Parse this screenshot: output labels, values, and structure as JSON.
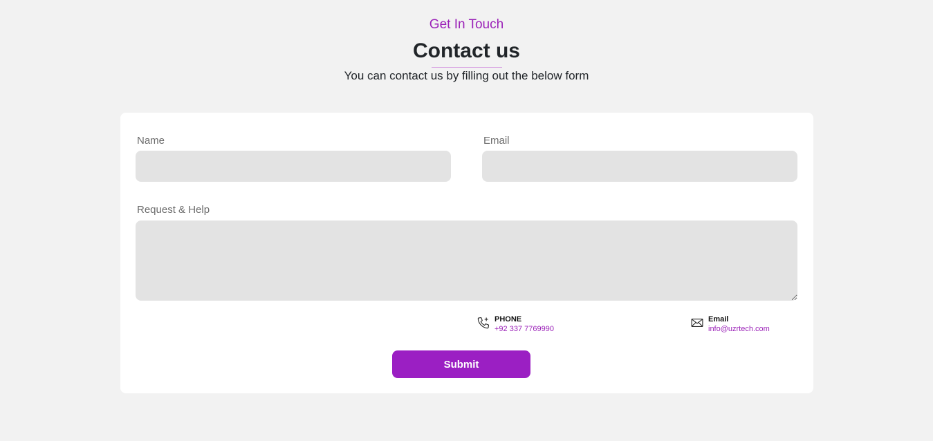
{
  "header": {
    "eyebrow": "Get In Touch",
    "title": "Contact us",
    "subtitle": "You can contact us by filling out the below form"
  },
  "form": {
    "name_label": "Name",
    "name_value": "",
    "email_label": "Email",
    "email_value": "",
    "request_label": "Request & Help",
    "request_value": "",
    "submit_label": "Submit"
  },
  "contact_info": {
    "phone": {
      "icon": "phone-icon",
      "label": "PHONE",
      "value": "+92 337 7769990"
    },
    "email": {
      "icon": "envelope-icon",
      "label": "Email",
      "value": "info@uzrtech.com"
    }
  },
  "colors": {
    "accent": "#9b22b8",
    "button": "#9b1fc3",
    "background": "#f2f2f2",
    "field": "#e3e3e3"
  }
}
